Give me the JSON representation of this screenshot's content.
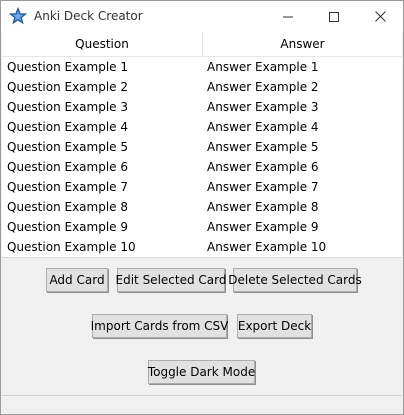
{
  "window": {
    "title": "Anki Deck Creator",
    "icon": "feather-star-icon"
  },
  "table": {
    "headers": [
      "Question",
      "Answer"
    ],
    "rows": [
      [
        "Question Example 1",
        "Answer Example 1"
      ],
      [
        "Question Example 2",
        "Answer Example 2"
      ],
      [
        "Question Example 3",
        "Answer Example 3"
      ],
      [
        "Question Example 4",
        "Answer Example 4"
      ],
      [
        "Question Example 5",
        "Answer Example 5"
      ],
      [
        "Question Example 6",
        "Answer Example 6"
      ],
      [
        "Question Example 7",
        "Answer Example 7"
      ],
      [
        "Question Example 8",
        "Answer Example 8"
      ],
      [
        "Question Example 9",
        "Answer Example 9"
      ],
      [
        "Question Example 10",
        "Answer Example 10"
      ]
    ]
  },
  "buttons": {
    "add_card": "Add Card",
    "edit_selected": "Edit Selected Card",
    "delete_selected": "Delete Selected Cards",
    "import_csv": "Import Cards from CSV",
    "export_deck": "Export Deck",
    "toggle_dark": "Toggle Dark Mode"
  }
}
